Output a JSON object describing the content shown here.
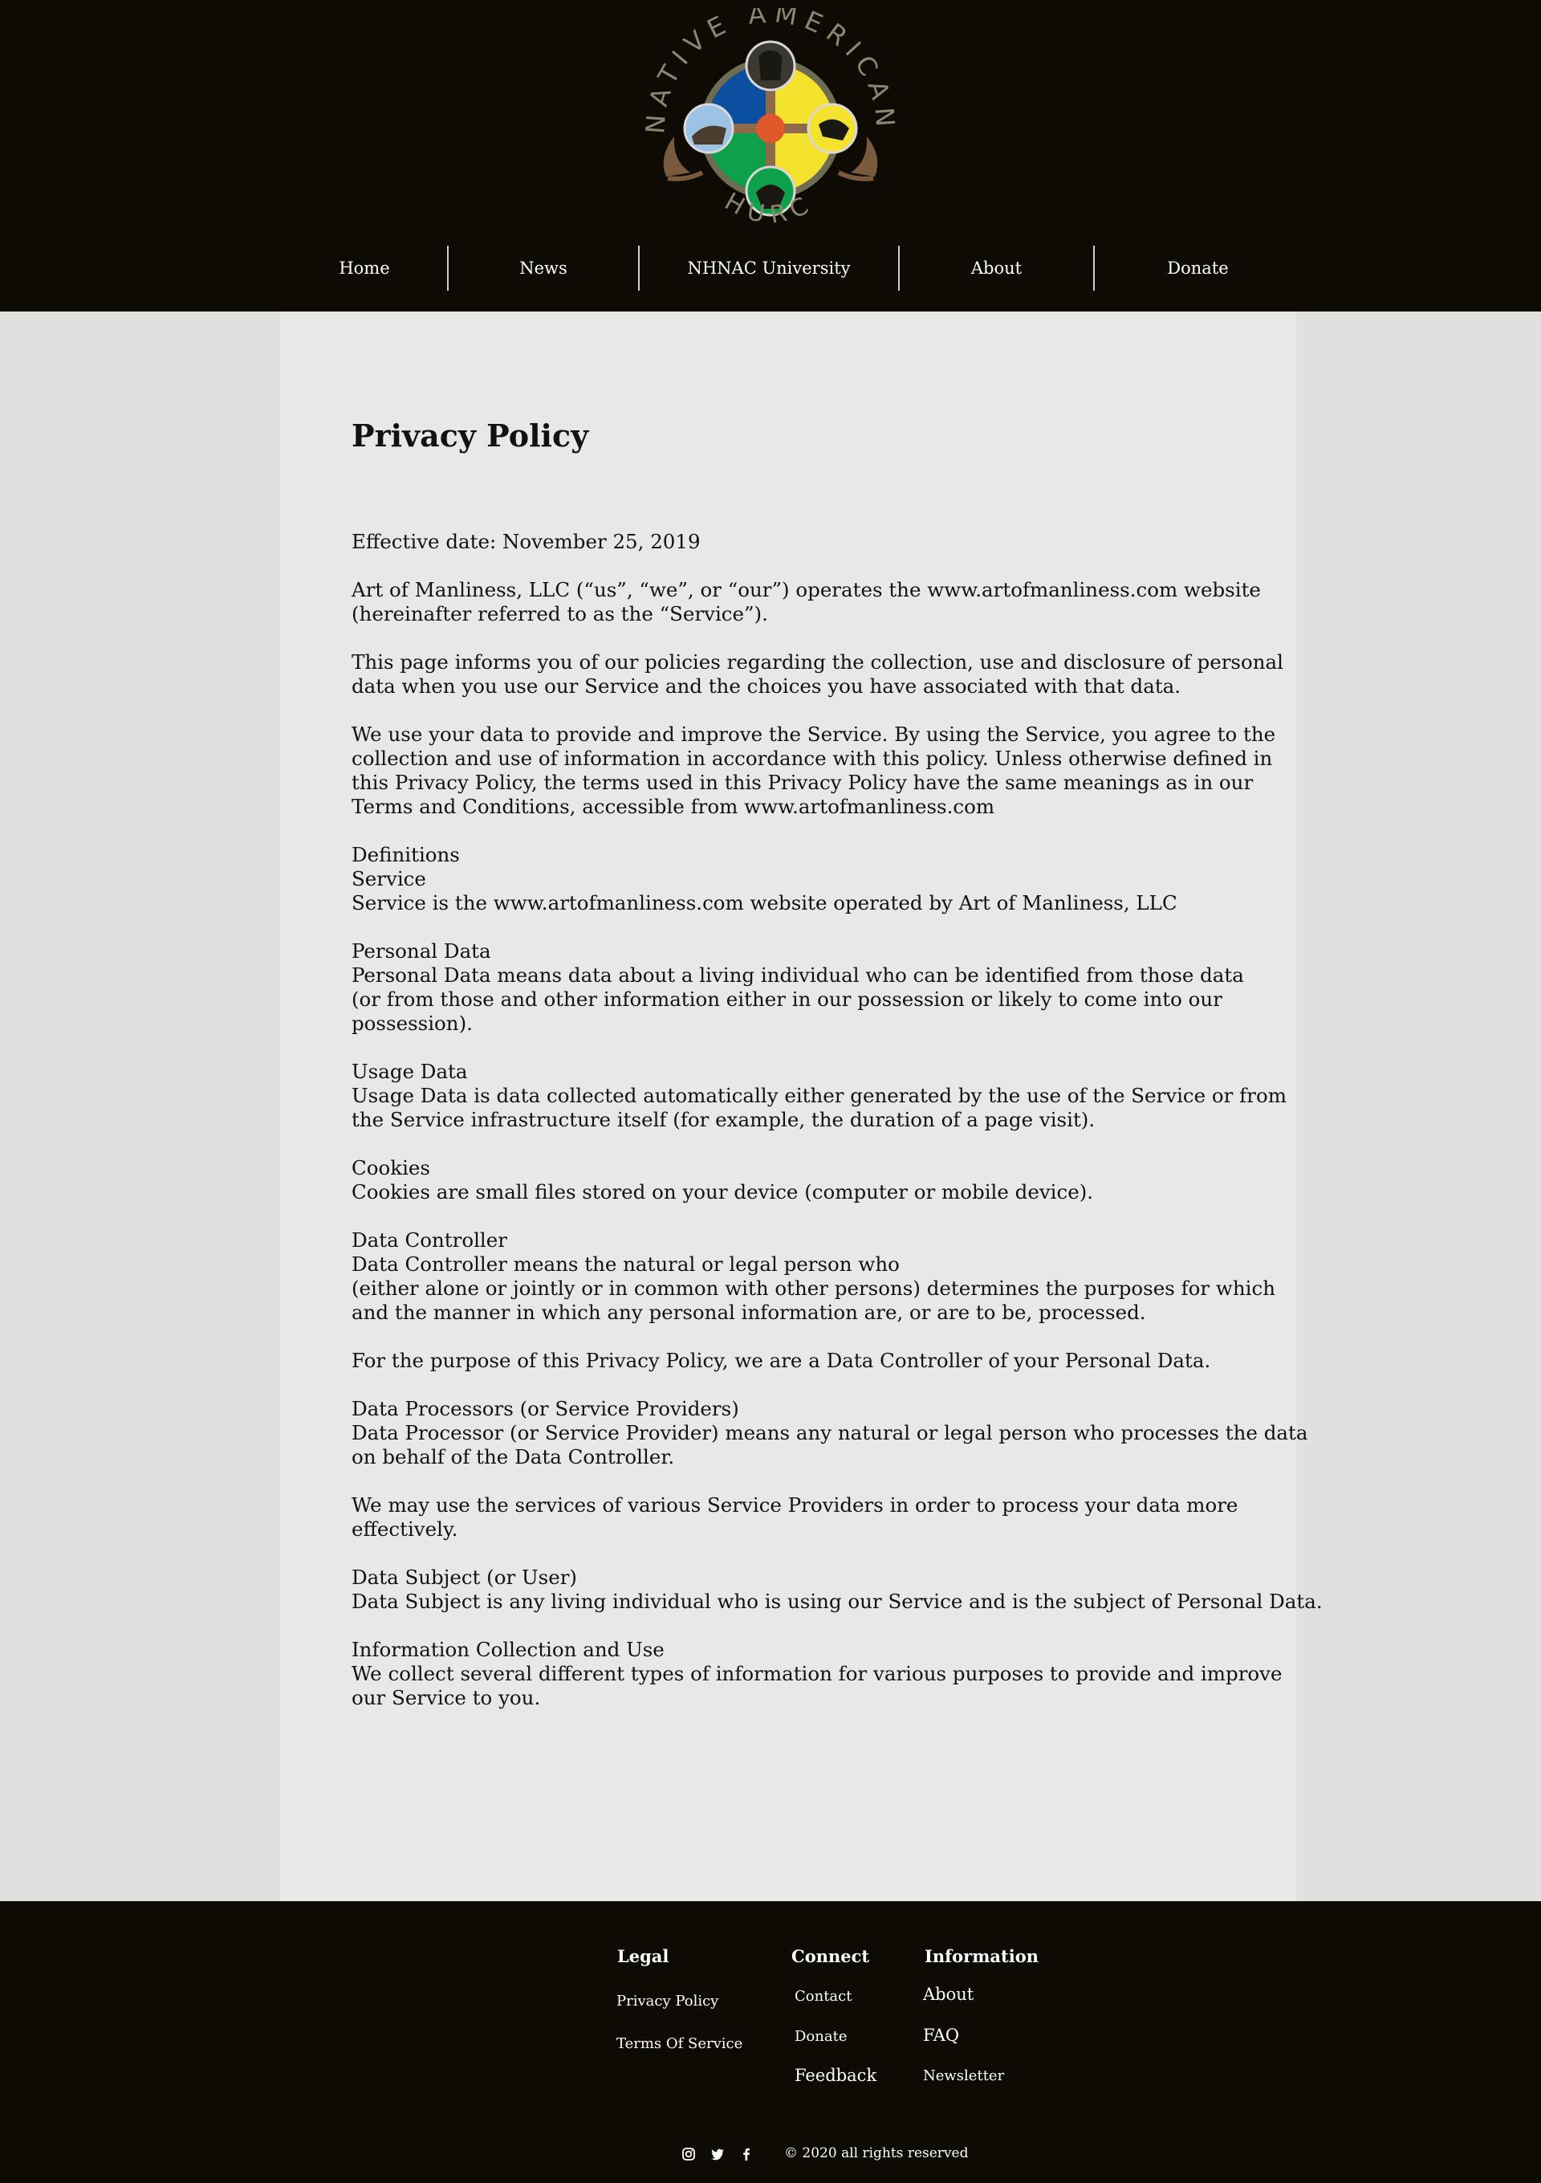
{
  "header": {
    "logo_text_top": "NATIVE AMERICAN",
    "logo_text_bottom": "CHURCH",
    "nav": [
      {
        "label": "Home"
      },
      {
        "label": "News"
      },
      {
        "label": "NHNAC University"
      },
      {
        "label": "About"
      },
      {
        "label": "Donate"
      }
    ]
  },
  "main": {
    "title": "Privacy Policy",
    "effective_date": "Effective date: November 25, 2019",
    "intro": [
      "Art of Manliness, LLC (“us”, “we”, or “our”) operates the www.artofmanliness.com website",
      "(hereinafter referred to as the “Service”)."
    ],
    "informs": [
      "This page informs you of our policies regarding the collection, use and disclosure of personal",
      "data when you use our Service and the choices you have associated with that data."
    ],
    "use": [
      "We use your data to provide and improve the Service. By using the Service, you agree to the",
      "collection and use of information in accordance with this policy. Unless otherwise defined in",
      "this Privacy Policy, the terms used in this Privacy Policy have the same meanings as in our",
      "Terms and Conditions, accessible from www.artofmanliness.com"
    ],
    "definitions": [
      "Definitions",
      "Service",
      "Service is the www.artofmanliness.com website operated by Art of Manliness, LLC"
    ],
    "personal_data": [
      "Personal Data",
      "Personal Data means data about a living individual who can be identified from those data",
      "(or from those and other information either in our possession or likely to come into our",
      "possession)."
    ],
    "usage_data": [
      "Usage Data",
      "Usage Data is data collected automatically either generated by the use of the Service or from",
      "the Service infrastructure itself (for example, the duration of a page visit)."
    ],
    "cookies": [
      "Cookies",
      "Cookies are small files stored on your device (computer or mobile device)."
    ],
    "data_controller": [
      "Data Controller",
      "Data Controller means the natural or legal person who",
      "(either alone or jointly or in common with other persons) determines the purposes for which",
      "and the manner in which any personal information are, or are to be, processed."
    ],
    "purpose": [
      "For the purpose of this Privacy Policy, we are a Data Controller of your Personal Data."
    ],
    "processors": [
      "Data Processors (or Service Providers)",
      "Data Processor (or Service Provider) means any natural or legal person who processes the data",
      "on behalf of the Data Controller."
    ],
    "providers": [
      "We may use the services of various Service Providers in order to process your data more",
      "effectively."
    ],
    "subject": [
      "Data Subject (or User)",
      "Data Subject is any living individual who is using our Service and is the subject of Personal Data."
    ],
    "collection": [
      "Information Collection and Use",
      "We collect several different types of information for various purposes to provide and improve",
      "our Service to you."
    ]
  },
  "footer": {
    "legal": {
      "heading": "Legal",
      "links": [
        "Privacy Policy",
        "Terms Of Service"
      ]
    },
    "connect": {
      "heading": "Connect",
      "links": [
        "Contact",
        "Donate",
        "Feedback"
      ]
    },
    "information": {
      "heading": "Information",
      "links": [
        "About",
        "FAQ",
        "Newsletter"
      ]
    },
    "social": [
      "instagram-icon",
      "twitter-icon",
      "facebook-icon"
    ],
    "copyright": "© 2020 all rights reserved"
  },
  "colors": {
    "header_bg": "#0e0b05",
    "page_bg": "#e1e0de",
    "content_bg": "#e8e8e6",
    "logo_blue": "#0a4fa0",
    "logo_yellow": "#f4e22c",
    "logo_green": "#0ea04a",
    "logo_orange": "#e0582a",
    "logo_ring": "#6f6c52"
  }
}
